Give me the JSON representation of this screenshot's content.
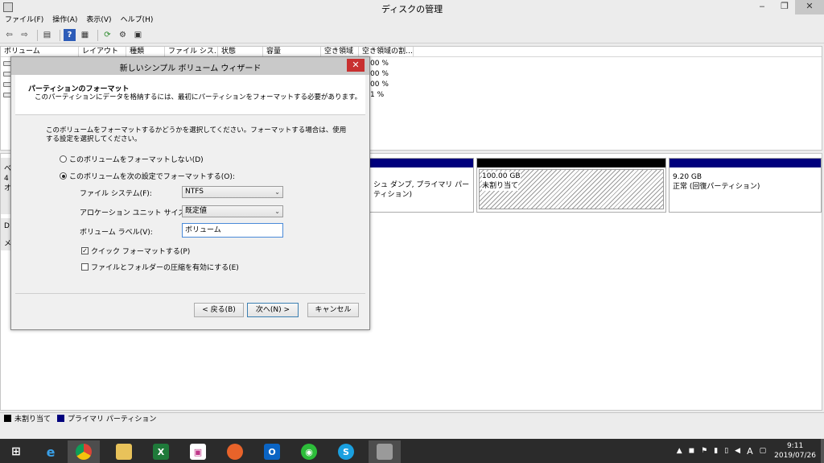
{
  "window": {
    "title": "ディスクの管理",
    "minimize": "‒",
    "restore": "❐",
    "close": "✕"
  },
  "menu": [
    "ファイル(F)",
    "操作(A)",
    "表示(V)",
    "ヘルプ(H)"
  ],
  "toolbar_icons": [
    "back-arrow-icon",
    "forward-arrow-icon",
    "disk-list-icon",
    "help-icon",
    "properties-icon",
    "refresh-icon",
    "settings-icon",
    "console-icon"
  ],
  "volume_list": {
    "columns": [
      "ボリューム",
      "レイアウト",
      "種類",
      "ファイル シス…",
      "状態",
      "容量",
      "空き領域",
      "空き領域の割…"
    ],
    "rows": [
      {
        "pct": "00 %"
      },
      {
        "pct": "00 %"
      },
      {
        "pct": "00 %"
      },
      {
        "pct": "1 %"
      }
    ]
  },
  "disk_area": {
    "partition_a": {
      "line2": "シュ ダンプ, プライマリ パーティション)"
    },
    "partition_b": {
      "size": "100.00 GB",
      "status": "未割り当て"
    },
    "partition_c": {
      "size": "9.20 GB",
      "status": "正常 (回復パーティション)"
    },
    "left_labels": [
      "ベ",
      "4",
      "オ",
      "D",
      "メ"
    ]
  },
  "legend": [
    {
      "label": "未割り当て",
      "color": "#000000"
    },
    {
      "label": "プライマリ パーティション",
      "color": "#00007d"
    }
  ],
  "wizard": {
    "title": "新しいシンプル ボリューム ウィザード",
    "header_title": "パーティションのフォーマット",
    "header_subtitle": "このパーティションにデータを格納するには、最初にパーティションをフォーマットする必要があります。",
    "instruction": "このボリュームをフォーマットするかどうかを選択してください。フォーマットする場合は、使用する設定を選択してください。",
    "radio_no_format": "このボリュームをフォーマットしない(D)",
    "radio_format": "このボリュームを次の設定でフォーマットする(O):",
    "fs_label": "ファイル システム(F):",
    "fs_value": "NTFS",
    "alloc_label": "アロケーション ユニット サイズ(A):",
    "alloc_value": "既定値",
    "vol_label_label": "ボリューム ラベル(V):",
    "vol_label_value": "ボリューム",
    "quick_format": "クイック フォーマットする(P)",
    "compression": "ファイルとフォルダーの圧縮を有効にする(E)",
    "back_button": "< 戻る(B)",
    "next_button": "次へ(N) >",
    "cancel_button": "キャンセル"
  },
  "taskbar": {
    "apps": [
      "start-icon",
      "internet-explorer-icon",
      "chrome-icon",
      "file-explorer-icon",
      "excel-icon",
      "paint-icon",
      "firefox-icon",
      "outlook-icon",
      "wechat-icon",
      "skype-icon",
      "disk-management-icon"
    ],
    "tray_ime": "A",
    "time": "9:11",
    "date": "2019/07/26"
  }
}
